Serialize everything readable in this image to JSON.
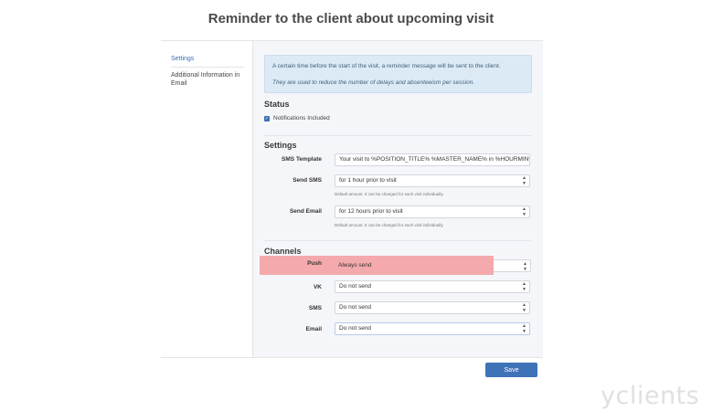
{
  "page": {
    "title": "Reminder to the client about upcoming visit"
  },
  "sidebar": {
    "items": [
      {
        "label": "Settings",
        "active": true
      },
      {
        "label": "Additional Information in Email",
        "active": false
      }
    ]
  },
  "info": {
    "line1": "A certain time before the start of the visit, a reminder message will be sent to the client.",
    "line2": "They are used to reduce the number of delays and absenteeism per session."
  },
  "status": {
    "heading": "Status",
    "notifications_label": "Notifications Included",
    "notifications_checked": true
  },
  "settings": {
    "heading": "Settings",
    "sms_template_label": "SMS Template",
    "sms_template_value": "Your visit to %POSITION_TITLE% %MASTER_NAME% in %HOURMIN%",
    "send_sms_label": "Send SMS",
    "send_sms_value": "for 1 hour prior to visit",
    "send_sms_hint": "Default amount. It can be changed for each visit individually.",
    "send_email_label": "Send Email",
    "send_email_value": "for 12 hours prior to visit",
    "send_email_hint": "Default amount. It can be changed for each visit individually."
  },
  "channels": {
    "heading": "Channels",
    "push_label": "Push",
    "push_value": "Always send",
    "vk_label": "VK",
    "vk_value": "Do not send",
    "sms_label": "SMS",
    "sms_value": "Do not send",
    "email_label": "Email",
    "email_value": "Do not send"
  },
  "actions": {
    "save_label": "Save"
  },
  "brand": {
    "logo_text": "yclients"
  },
  "colors": {
    "accent": "#3f73b8",
    "highlight": "#f3a5a8",
    "info_bg": "#dceaf5"
  }
}
